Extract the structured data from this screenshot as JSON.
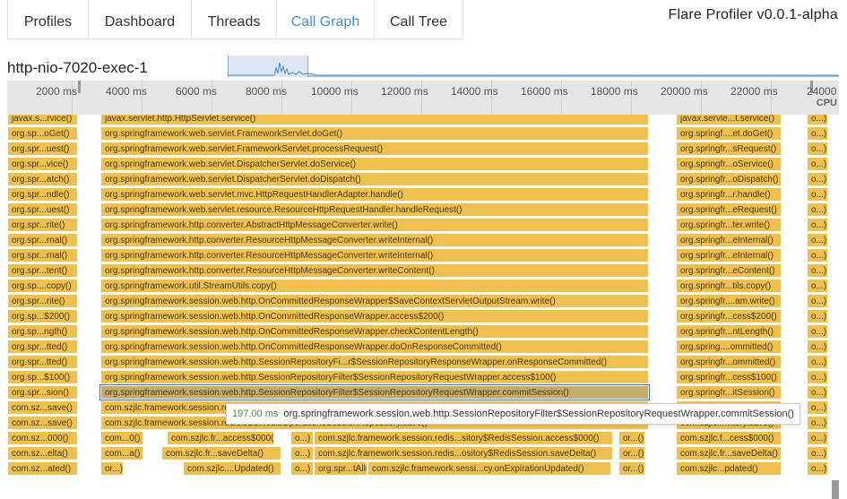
{
  "app": {
    "title": "Flare Profiler v0.0.1-alpha"
  },
  "tabs": [
    {
      "label": "Profiles",
      "active": false
    },
    {
      "label": "Dashboard",
      "active": false
    },
    {
      "label": "Threads",
      "active": false
    },
    {
      "label": "Call Graph",
      "active": true
    },
    {
      "label": "Call Tree",
      "active": false
    }
  ],
  "thread": {
    "name": "http-nio-7020-exec-1"
  },
  "axis": {
    "labels": [
      "2000 ms",
      "4000 ms",
      "6000 ms",
      "8000 ms",
      "10000 ms",
      "12000 ms",
      "14000 ms",
      "16000 ms",
      "18000 ms",
      "20000 ms",
      "22000 ms",
      "24000"
    ],
    "cpu_label": "CPU"
  },
  "columns": [
    {
      "id": "a",
      "rows": [
        "javax.s...rvice()",
        "org.sp...oGet()",
        "org.spr...uest()",
        "org.spr...vice()",
        "org.spr...atch()",
        "org.spr...ndle()",
        "org.spr...uest()",
        "org.spr...rite()",
        "org.spr...rnal()",
        "org.spr...rnal()",
        "org.spr...tent()",
        "org.sp....copy()",
        "org.spr...rite()",
        "org.sp...$200()",
        "org.sp...ngth()",
        "org.spr...tted()",
        "org.spr...tted()",
        "org.sp...$100()",
        "org.spr...sion()",
        "com.sz...save()",
        "com.sz...save()",
        "com.sz...000()",
        "com.sz...elta()",
        "com.sz...ated()"
      ]
    },
    {
      "id": "b",
      "rows": [
        "javax.servlet.http.HttpServlet.service()",
        "org.springframework.web.servlet.FrameworkServlet.doGet()",
        "org.springframework.web.servlet.FrameworkServlet.processRequest()",
        "org.springframework.web.servlet.DispatcherServlet.doService()",
        "org.springframework.web.servlet.DispatcherServlet.doDispatch()",
        "org.springframework.web.servlet.mvc.HttpRequestHandlerAdapter.handle()",
        "org.springframework.web.servlet.resource.ResourceHttpRequestHandler.handleRequest()",
        "org.springframework.http.converter.AbstractHttpMessageConverter.write()",
        "org.springframework.http.converter.ResourceHttpMessageConverter.writeInternal()",
        "org.springframework.http.converter.ResourceHttpMessageConverter.writeInternal()",
        "org.springframework.http.converter.ResourceHttpMessageConverter.writeContent()",
        "org.springframework.util.StreamUtils.copy()",
        "org.springframework.session.web.http.OnCommittedResponseWrapper$SaveContextServletOutputStream.write()",
        "org.springframework.session.web.http.OnCommittedResponseWrapper.access$200()",
        "org.springframework.session.web.http.OnCommittedResponseWrapper.checkContentLength()",
        "org.springframework.session.web.http.OnCommittedResponseWrapper.doOnResponseCommitted()",
        "org.springframework.session.web.http.SessionRepositoryFi...r$SessionRepositoryResponseWrapper.onResponseCommitted()",
        "org.springframework.session.web.http.SessionRepositoryFilter$SessionRepositoryRequestWrapper.access$100()",
        "org.springframework.session.web.http.SessionRepositoryFilter$SessionRepositoryRequestWrapper.commitSession()",
        "com.szjlc.framework.session.redis.JLCRedisOperationsSessionRepository.save()",
        "com.szjlc.framework.session.redis.JLCRedisOperationsSessionRepository.save()"
      ]
    },
    {
      "id": "c",
      "rows": [
        "javax.servle...t.service()",
        "org.springf....et.doGet()",
        "org.springfr...sRequest()",
        "org.springfr...oService()",
        "org.springfr...oDispatch()",
        "org.springfr...r.handle()",
        "org.springfr...eRequest()",
        "org.springfr...ter.write()",
        "org.springfr...eInternal()",
        "org.springfr...eInternal()",
        "org.springfr...eContent()",
        "org.springfr...tils.copy()",
        "org.springfr....am.write()",
        "org.springfr...cess$200()",
        "org.springfr...ntLength()",
        "org.spring....ommitted()",
        "org.springfr...ommitted()",
        "org.springfr...cess$100()",
        "org.springfr...itSession()",
        "com.szjlc.fr...ory.save()",
        "com.szjlc.fr...tory.save()",
        "com.szjlc.f...cess$000()",
        "com.szjlc.fr...saveDelta()",
        "com.szjlc...pdated()"
      ]
    },
    {
      "id": "d",
      "rows": [
        "o...)",
        "o...)",
        "o...)",
        "o...)",
        "o...)",
        "o...)",
        "o...)",
        "o...)",
        "o...)",
        "o...)",
        "o...)",
        "o...)",
        "o...)",
        "o...)",
        "o...)",
        "o...)",
        "o...)",
        "o...)",
        "o...)",
        "o...)",
        "o...)",
        "o...)",
        "o...)",
        "o...)"
      ]
    }
  ],
  "deep_rows": {
    "row21": [
      "com...0()",
      "com.szjlc.fr...access$000()",
      "o...)",
      "com.szjlc.framework.session.redis...sitory$RedisSession.access$000()",
      "or...()"
    ],
    "row22": [
      "com...a()",
      "com.szjlc.fr...saveDelta()",
      "o...)",
      "com.szjlc.framework.session.redis...ository$RedisSession.saveDelta()",
      "or...()"
    ],
    "row23": [
      "or...)",
      "com.szjlc....Updated()",
      "o...)",
      "org.spr...tAll()",
      "com.szjlc.framework.sessi...cy.onExpirationUpdated()",
      "or...()"
    ]
  },
  "tooltip": {
    "duration": "197.00 ms",
    "method": "org.springframework.session.web.http.SessionRepositoryFilter$SessionRepositoryRequestWrapper.commitSession()"
  }
}
